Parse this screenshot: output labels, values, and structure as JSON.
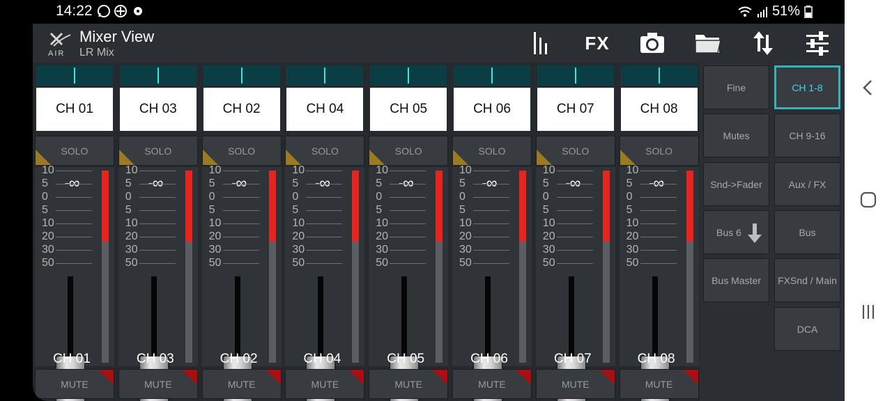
{
  "status_bar": {
    "time": "14:22",
    "battery": "51%",
    "icons": [
      "whatsapp-icon",
      "compass-icon",
      "settings-gear-icon",
      "wifi-icon",
      "signal-icon",
      "battery-icon"
    ]
  },
  "app": {
    "title": "Mixer View",
    "subtitle": "LR Mix",
    "logo_icon": "x-air-logo",
    "toolbar": {
      "fx_label": "FX",
      "icons": [
        "meters-icon",
        "fx-label",
        "camera-icon",
        "folder-icon",
        "arrows-updown-icon",
        "sliders-icon"
      ]
    },
    "colors": {
      "accent": "#35b3b8",
      "meter_red": "#e8241f",
      "solo_indicator": "#9a7a22",
      "mute_indicator": "#a80f12",
      "pan_bg": "#0b3e44",
      "pan_indicator": "#3fe3e3"
    }
  },
  "strip_labels": {
    "solo": "SOLO",
    "mute": "MUTE",
    "level": "-∞"
  },
  "scale_labels": [
    "10",
    "5",
    "0",
    "5",
    "10",
    "20",
    "30",
    "50"
  ],
  "channels": [
    {
      "name": "CH 01"
    },
    {
      "name": "CH 03"
    },
    {
      "name": "CH 02"
    },
    {
      "name": "CH 04"
    },
    {
      "name": "CH 05"
    },
    {
      "name": "CH 06"
    },
    {
      "name": "CH 07"
    },
    {
      "name": "CH 08"
    }
  ],
  "side_panel": {
    "buttons": [
      {
        "label": "Fine",
        "active": false
      },
      {
        "label": "CH 1-8",
        "active": true
      },
      {
        "label": "Mutes",
        "active": false
      },
      {
        "label": "CH 9-16",
        "active": false
      },
      {
        "label": "Snd->Fader",
        "active": false
      },
      {
        "label": "Aux / FX",
        "active": false
      },
      {
        "label": "Bus 6",
        "active": false,
        "icon": "arrow-down-icon"
      },
      {
        "label": "Bus",
        "active": false
      },
      {
        "label": "Bus Master",
        "active": false
      },
      {
        "label": "FXSnd / Main",
        "active": false
      },
      {
        "label": "DCA",
        "active": false
      }
    ]
  },
  "nav_bar": {
    "icons": [
      "back-chevron-icon",
      "home-icon",
      "recents-icon"
    ]
  }
}
